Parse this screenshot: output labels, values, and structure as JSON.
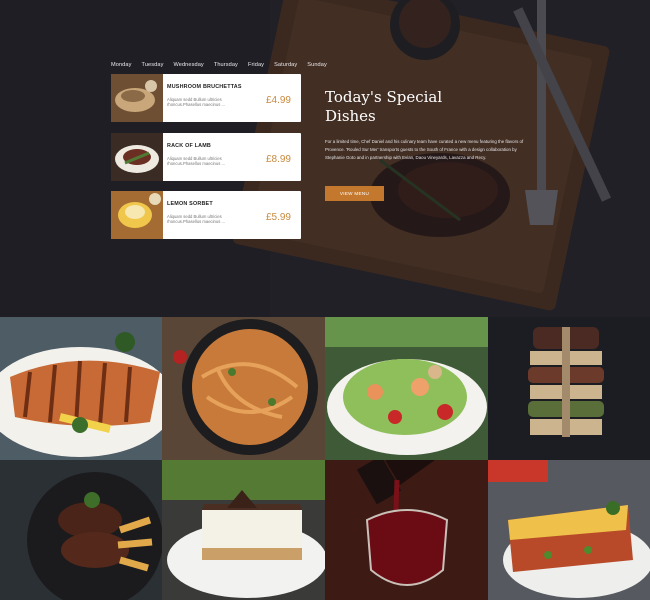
{
  "days": [
    "Monday",
    "Tuesday",
    "Wednesday",
    "Thursday",
    "Friday",
    "Saturday",
    "Sunday"
  ],
  "menu_items": [
    {
      "name": "MUSHROOM BRUCHETTAS",
      "desc": "Aliquam sedd Bullum ultricies rhoncus.Phasellus maecinus ...",
      "price": "£4.99"
    },
    {
      "name": "RACK OF LAMB",
      "desc": "Aliquam sedd Bullum ultricies rhoncus.Phasellus maecinus ...",
      "price": "£8.99"
    },
    {
      "name": "LEMON SORBET",
      "desc": "Aliquam sedd Bullum ultricies rhoncus.Phasellus maecinus ...",
      "price": "£5.99"
    }
  ],
  "special": {
    "title": "Today's Special Dishes",
    "text": "For a limited time, Chef Daniel and his culinary team have curated a new menu featuring the flavors of Provence. 'Rouled Sur Mer' transports guests to the South of France with a design collaboration by Stephanie Goto and in partnership with Evian, Daou Vineyards, Lavazza and Recy.",
    "button": "VIEW MENU"
  },
  "colors": {
    "accent": "#c4782e",
    "price": "#c98a3f",
    "overlay": "#14141c"
  },
  "gallery": [
    "grilled-salmon-photo",
    "pasta-pan-photo",
    "shrimp-salad-photo",
    "stacked-sandwich-photo",
    "steak-fries-photo",
    "cream-pie-photo",
    "red-wine-photo",
    "shepherds-pie-photo"
  ]
}
